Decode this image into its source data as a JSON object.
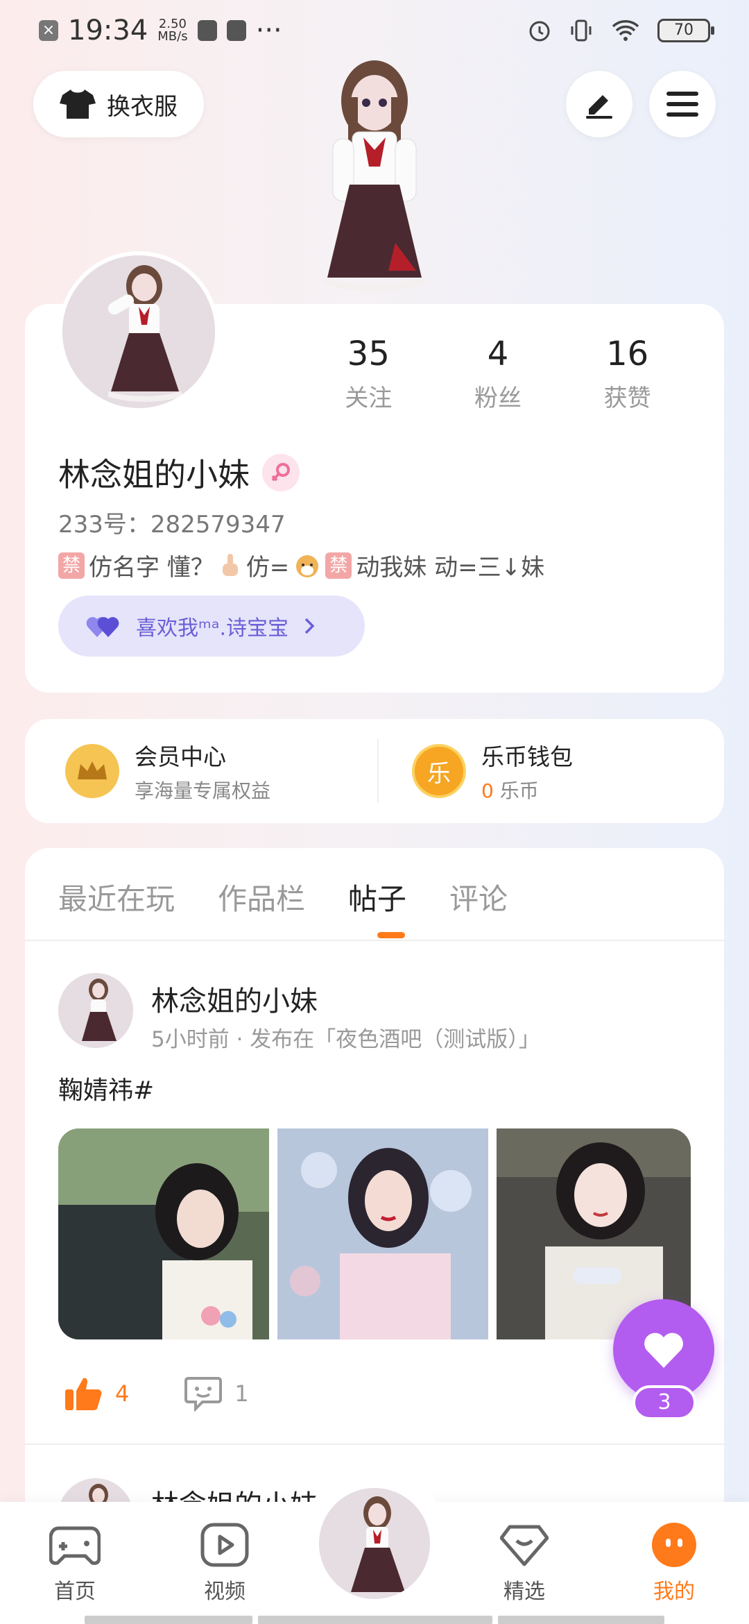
{
  "status_bar": {
    "time": "19:34",
    "net_speed_value": "2.50",
    "net_speed_unit": "MB/s",
    "more": "···",
    "battery": "70"
  },
  "top_bar": {
    "outfit_label": "换衣服"
  },
  "profile": {
    "stats": [
      {
        "num": "35",
        "label": "关注"
      },
      {
        "num": "4",
        "label": "粉丝"
      },
      {
        "num": "16",
        "label": "获赞"
      }
    ],
    "username": "林念姐的小妹",
    "uid": "233号：282579347",
    "bio": {
      "ban1": "禁",
      "part1": "仿名字 懂？",
      "part2": " 仿=",
      "ban2": "禁",
      "part3": "动我妹 动=三↓妹"
    },
    "like_pill": "喜欢我ᵐᵃ.诗宝宝"
  },
  "member": {
    "title": "会员中心",
    "sub": "享海量专属权益"
  },
  "wallet": {
    "title": "乐币钱包",
    "coin_char": "乐",
    "amount": "0",
    "unit": " 乐币"
  },
  "tabs": [
    {
      "label": "最近在玩"
    },
    {
      "label": "作品栏"
    },
    {
      "label": "帖子"
    },
    {
      "label": "评论"
    }
  ],
  "post": {
    "author": "林念姐的小妹",
    "meta": "5小时前 · 发布在「夜色酒吧（测试版）」",
    "text": "鞠婧祎#",
    "likes": "4",
    "comments": "1"
  },
  "post2": {
    "author": "林念姐的小妹"
  },
  "fab": {
    "count": "3"
  },
  "nav": [
    {
      "label": "首页"
    },
    {
      "label": "视频"
    },
    {
      "label": "精选"
    },
    {
      "label": "我的"
    }
  ],
  "colors": {
    "accent": "#ff7a1a",
    "purple": "#b35cf0",
    "pill_bg": "#e6e4fb"
  }
}
